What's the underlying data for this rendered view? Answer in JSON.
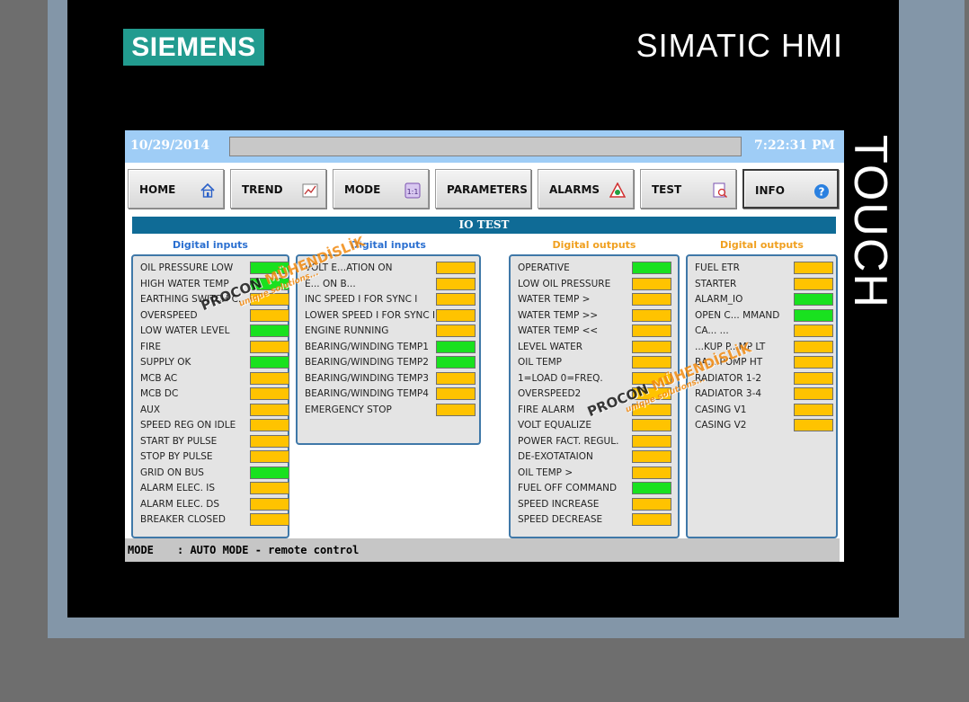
{
  "hardware": {
    "logo_text": "SIEMENS",
    "brand_text": "SIMATIC HMI",
    "side_text": "TOUCH"
  },
  "topbar": {
    "date": "10/29/2014",
    "time": "7:22:31 PM",
    "message": ""
  },
  "nav": [
    {
      "label": "HOME",
      "icon": "home-icon"
    },
    {
      "label": "TREND",
      "icon": "trend-icon"
    },
    {
      "label": "MODE",
      "icon": "mode-icon"
    },
    {
      "label": "PARAMETERS",
      "icon": ""
    },
    {
      "label": "ALARMS",
      "icon": "alarm-icon"
    },
    {
      "label": "TEST",
      "icon": "test-icon"
    },
    {
      "label": "INFO",
      "icon": "info-icon"
    }
  ],
  "page_title": "IO TEST",
  "columns": [
    {
      "heading": "Digital inputs",
      "items": [
        {
          "name": "OIL PRESSURE LOW",
          "state": "green"
        },
        {
          "name": "HIGH WATER TEMP",
          "state": "green"
        },
        {
          "name": "EARTHING SWITCH C.",
          "state": "yellow"
        },
        {
          "name": "OVERSPEED",
          "state": "yellow"
        },
        {
          "name": "LOW WATER LEVEL",
          "state": "green"
        },
        {
          "name": "FIRE",
          "state": "yellow"
        },
        {
          "name": "SUPPLY OK",
          "state": "green"
        },
        {
          "name": "MCB AC",
          "state": "yellow"
        },
        {
          "name": "MCB DC",
          "state": "yellow"
        },
        {
          "name": "AUX",
          "state": "yellow"
        },
        {
          "name": "SPEED REG ON IDLE",
          "state": "yellow"
        },
        {
          "name": "START BY PULSE",
          "state": "yellow"
        },
        {
          "name": "STOP BY PULSE",
          "state": "yellow"
        },
        {
          "name": "GRID ON BUS",
          "state": "green"
        },
        {
          "name": "ALARM ELEC. IS",
          "state": "yellow"
        },
        {
          "name": "ALARM ELEC. DS",
          "state": "yellow"
        },
        {
          "name": "BREAKER CLOSED",
          "state": "yellow"
        }
      ]
    },
    {
      "heading": "Digital inputs",
      "items": [
        {
          "name": "VOLT E...ATION ON",
          "state": "yellow"
        },
        {
          "name": "E... ON B...",
          "state": "yellow"
        },
        {
          "name": "INC SPEED I FOR SYNC I",
          "state": "yellow"
        },
        {
          "name": "LOWER SPEED I FOR SYNC I",
          "state": "yellow"
        },
        {
          "name": "ENGINE RUNNING",
          "state": "yellow"
        },
        {
          "name": "BEARING/WINDING TEMP1",
          "state": "green"
        },
        {
          "name": "BEARING/WINDING TEMP2",
          "state": "green"
        },
        {
          "name": "BEARING/WINDING TEMP3",
          "state": "yellow"
        },
        {
          "name": "BEARING/WINDING TEMP4",
          "state": "yellow"
        },
        {
          "name": "EMERGENCY STOP",
          "state": "yellow"
        }
      ]
    },
    {
      "heading": "Digital outputs",
      "items": [
        {
          "name": "OPERATIVE",
          "state": "green"
        },
        {
          "name": "LOW OIL PRESSURE",
          "state": "yellow"
        },
        {
          "name": "WATER TEMP >",
          "state": "yellow"
        },
        {
          "name": "WATER TEMP >>",
          "state": "yellow"
        },
        {
          "name": "WATER TEMP <<",
          "state": "yellow"
        },
        {
          "name": "LEVEL WATER",
          "state": "yellow"
        },
        {
          "name": "OIL TEMP",
          "state": "yellow"
        },
        {
          "name": "1=LOAD 0=FREQ.",
          "state": "yellow"
        },
        {
          "name": "OVERSPEED2",
          "state": "yellow"
        },
        {
          "name": "FIRE ALARM",
          "state": "yellow"
        },
        {
          "name": "VOLT EQUALIZE",
          "state": "yellow"
        },
        {
          "name": "POWER FACT. REGUL.",
          "state": "yellow"
        },
        {
          "name": "DE-EXOTATAION",
          "state": "yellow"
        },
        {
          "name": "OIL TEMP >",
          "state": "yellow"
        },
        {
          "name": "FUEL OFF COMMAND",
          "state": "green"
        },
        {
          "name": "SPEED INCREASE",
          "state": "yellow"
        },
        {
          "name": "SPEED DECREASE",
          "state": "yellow"
        }
      ]
    },
    {
      "heading": "Digital outputs",
      "items": [
        {
          "name": "FUEL ETR",
          "state": "yellow"
        },
        {
          "name": "STARTER",
          "state": "yellow"
        },
        {
          "name": "ALARM_IO",
          "state": "green"
        },
        {
          "name": "OPEN C... MMAND",
          "state": "green"
        },
        {
          "name": "CA... ...",
          "state": "yellow"
        },
        {
          "name": "...KUP P...MP LT",
          "state": "yellow"
        },
        {
          "name": "BA... POMP HT",
          "state": "yellow"
        },
        {
          "name": "RADIATOR 1-2",
          "state": "yellow"
        },
        {
          "name": "RADIATOR 3-4",
          "state": "yellow"
        },
        {
          "name": "CASING V1",
          "state": "yellow"
        },
        {
          "name": "CASING V2",
          "state": "yellow"
        }
      ]
    }
  ],
  "status": {
    "key": "MODE",
    "value": ": AUTO MODE - remote control"
  },
  "watermark": {
    "brand_a": "PROCON",
    "brand_b": " MÜHENDİSLİK",
    "tagline": "unique solutions..."
  },
  "colors": {
    "green": "#19e11f",
    "yellow": "#ffc300"
  }
}
